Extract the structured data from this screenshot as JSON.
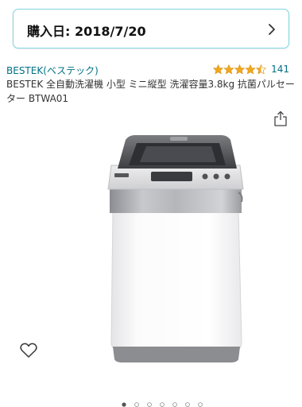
{
  "purchase": {
    "date_text": "購入日: 2018/7/20"
  },
  "product": {
    "brand": "BESTEK(ベステック)",
    "rating_stars": 4.5,
    "review_count": "141",
    "title": "BESTEK 全自動洗濯機 小型 ミニ縦型 洗濯容量3.8kg 抗菌パルセーター BTWA01"
  },
  "icons": {
    "chevron": "chevron-right-icon",
    "share": "share-icon",
    "wishlist": "heart-outline-icon",
    "rating": "star-icon"
  },
  "carousel": {
    "total_images": 7,
    "active_index": 0
  },
  "colors": {
    "link": "#007185",
    "star": "#f1a81c",
    "card_border": "#7fd4df"
  }
}
